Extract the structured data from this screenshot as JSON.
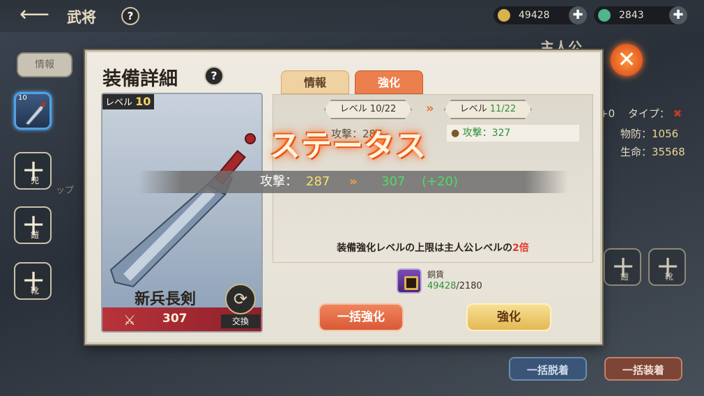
{
  "topbar": {
    "title": "武将",
    "help": "?",
    "coins": "49428",
    "gems": "2843"
  },
  "background": {
    "info_tab": "情報",
    "protagonist": "主人公",
    "slot_level": "10",
    "slots": [
      {
        "label": "兜"
      },
      {
        "label": "鎧"
      },
      {
        "label": "靴"
      }
    ],
    "right_slots": [
      {
        "label": "鎧"
      },
      {
        "label": "靴"
      }
    ],
    "type_label": "タイプ：",
    "type_prefix": "+0",
    "def_label": "物防：",
    "def_value": "1056",
    "hp_label": "生命：",
    "hp_value": "35568",
    "unequip_all": "一括脱着",
    "equip_all": "一括装着",
    "side_text": "ップ"
  },
  "panel": {
    "title": "装備詳細",
    "help": "?",
    "item": {
      "level_label": "レベル",
      "level": "10",
      "name": "新兵長剣",
      "power": "307",
      "exchange": "交換"
    },
    "tabs": [
      {
        "label": "情報",
        "active": false
      },
      {
        "label": "強化",
        "active": true
      }
    ],
    "enhance": {
      "level_from_label": "レベル",
      "level_from": "10/22",
      "level_to_label": "レベル",
      "level_to": "11/22",
      "stat_before": "攻撃：287",
      "stat_after_key": "攻撃：",
      "stat_after_value": "327",
      "banner": "ステータス",
      "overlay": {
        "label": "攻撃：",
        "old": "287",
        "arrows": "»",
        "new": "307",
        "diff": "(+20)"
      },
      "limit_text_pre": "装備強化レベルの上限は主人公レベルの",
      "limit_text_hl": "2倍",
      "cost_name": "銅貨",
      "cost_have": "49428",
      "cost_need": "/2180",
      "bulk_button": "一括強化",
      "enhance_button": "強化"
    }
  },
  "colors": {
    "accent_orange": "#ec7f4e",
    "green": "#2f8f3d",
    "yellow": "#f5e26a"
  }
}
